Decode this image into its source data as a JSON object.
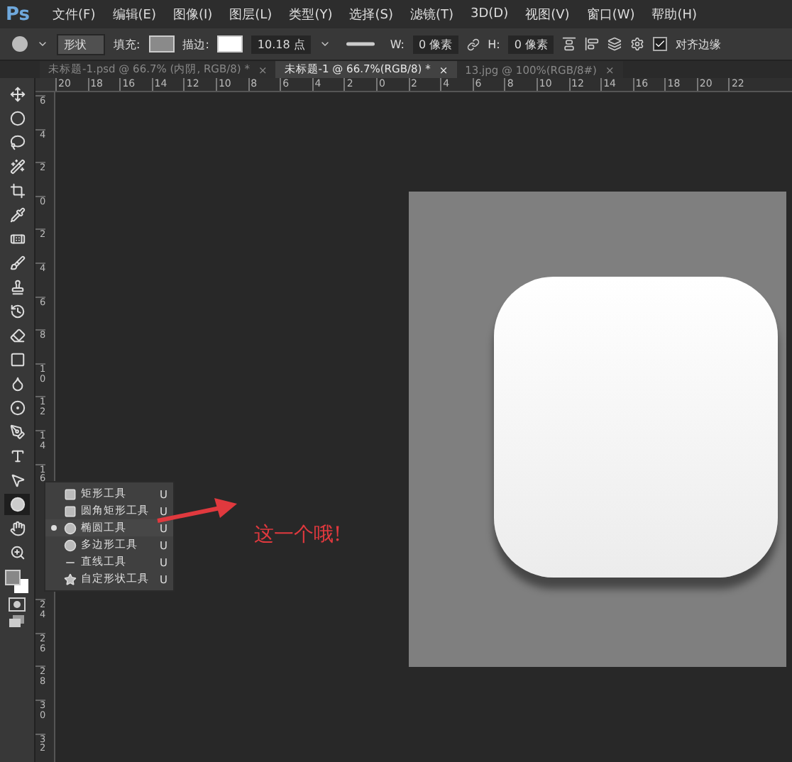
{
  "app_logo": "Ps",
  "menu": [
    "文件(F)",
    "编辑(E)",
    "图像(I)",
    "图层(L)",
    "类型(Y)",
    "选择(S)",
    "滤镜(T)",
    "3D(D)",
    "视图(V)",
    "窗口(W)",
    "帮助(H)"
  ],
  "options_bar": {
    "mode": "形状",
    "fill_label": "填充:",
    "stroke_label": "描边:",
    "stroke_width": "10.18 点",
    "w_label": "W:",
    "w_value": "0 像素",
    "h_label": "H:",
    "h_value": "0 像素",
    "align_edges": {
      "label": "对齐边缘",
      "checked": true
    }
  },
  "tabs": [
    {
      "label": "未标题-1.psd @ 66.7% (内阴, RGB/8) *",
      "close": "×",
      "selected": false
    },
    {
      "label": "未标题-1 @ 66.7%(RGB/8) *",
      "close": "×",
      "selected": true
    },
    {
      "label": "13.jpg @ 100%(RGB/8#)",
      "close": "×",
      "selected": false
    }
  ],
  "top_ruler": [
    "20",
    "18",
    "16",
    "14",
    "12",
    "10",
    "8",
    "6",
    "4",
    "2",
    "0",
    "2",
    "4",
    "6",
    "8",
    "10",
    "12",
    "14",
    "16",
    "18",
    "20",
    "22"
  ],
  "left_ruler": {
    "upper": [
      "6",
      "4",
      "2",
      "0",
      "2",
      "4",
      "6",
      "8",
      "10",
      "12",
      "14",
      "16"
    ],
    "lower": [
      "24",
      "26",
      "28",
      "30",
      "32"
    ]
  },
  "tools": [
    {
      "selected": false
    },
    {
      "selected": false
    },
    {
      "selected": false
    },
    {
      "selected": false
    },
    {
      "selected": false
    },
    {
      "selected": false
    },
    {
      "selected": false
    },
    {
      "selected": false
    },
    {
      "selected": false
    },
    {
      "selected": false
    },
    {
      "selected": false
    },
    {
      "selected": false
    },
    {
      "selected": false
    },
    {
      "selected": false
    },
    {
      "selected": false
    },
    {
      "selected": false
    },
    {
      "selected": false
    },
    {
      "selected": true
    },
    {
      "selected": false
    },
    {
      "selected": false
    }
  ],
  "flyout": [
    {
      "label": "矩形工具",
      "shortcut": "U",
      "selected": false
    },
    {
      "label": "圆角矩形工具",
      "shortcut": "U",
      "selected": false
    },
    {
      "label": "椭圆工具",
      "shortcut": "U",
      "selected": true
    },
    {
      "label": "多边形工具",
      "shortcut": "U",
      "selected": false
    },
    {
      "label": "直线工具",
      "shortcut": "U",
      "selected": false
    },
    {
      "label": "自定形状工具",
      "shortcut": "U",
      "selected": false
    }
  ],
  "annotation": "这一个哦!"
}
